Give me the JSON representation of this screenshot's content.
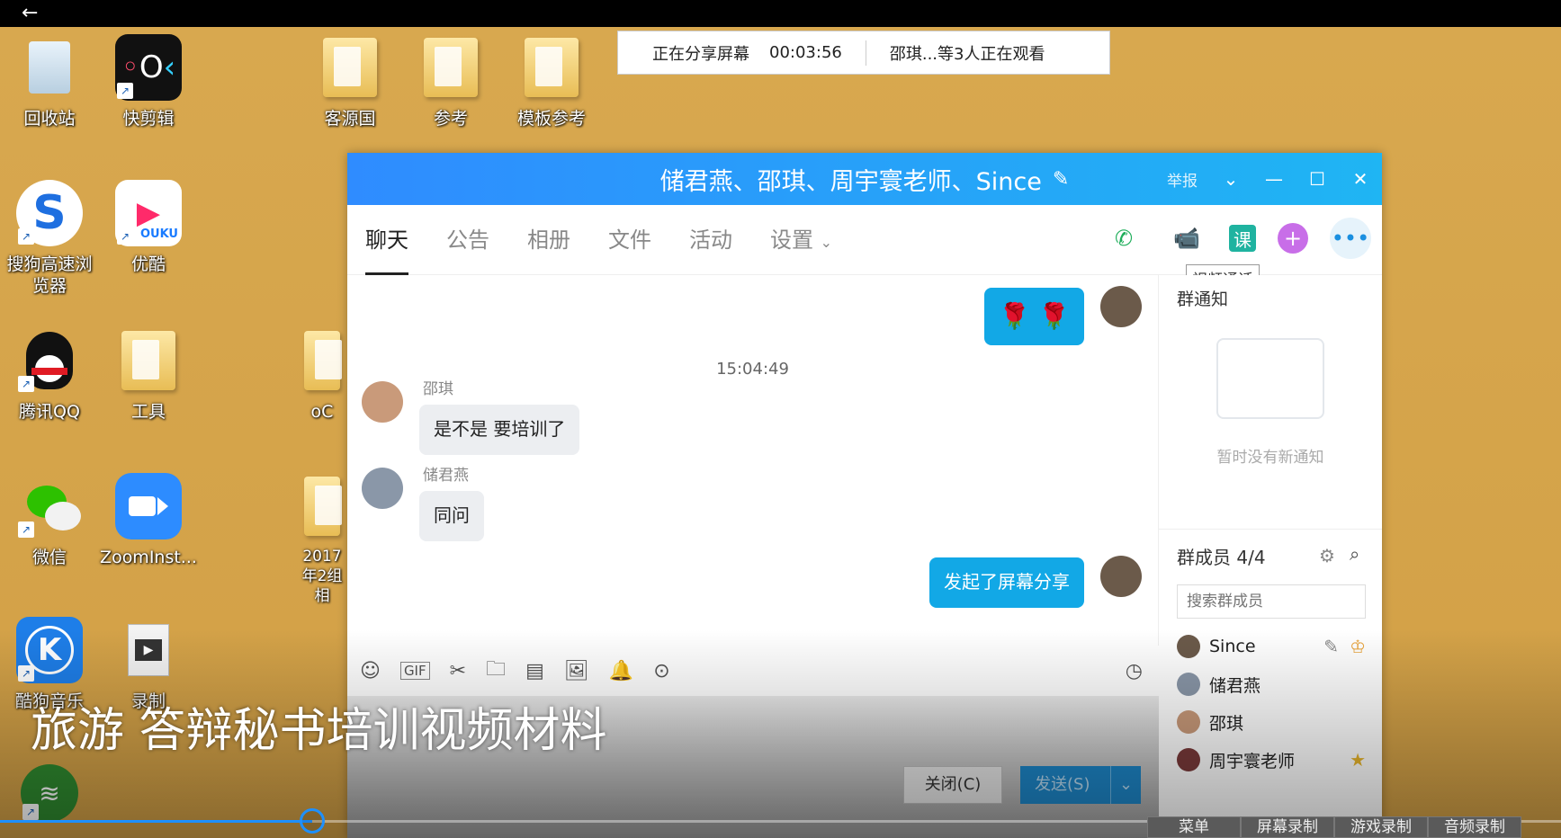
{
  "topbar": {
    "back_icon": "back-arrow-icon"
  },
  "desktop_icons": [
    {
      "label": "回收站"
    },
    {
      "label": "快剪辑"
    },
    {
      "label": "客源国"
    },
    {
      "label": "参考"
    },
    {
      "label": "模板参考"
    },
    {
      "label": "搜狗高速浏览器"
    },
    {
      "label": "优酷"
    },
    {
      "label": "腾讯QQ"
    },
    {
      "label": "工具"
    },
    {
      "label": "oC"
    },
    {
      "label": "微信"
    },
    {
      "label": "ZoomInst..."
    },
    {
      "label": "2017年2组相"
    },
    {
      "label": "酷狗音乐"
    },
    {
      "label": "录制"
    }
  ],
  "share_bar": {
    "status": "正在分享屏幕",
    "elapsed": "00:03:56",
    "viewers": "邵琪...等3人正在观看"
  },
  "qq_window": {
    "title": "储君燕、邵琪、周宇寰老师、Since",
    "report": "举报",
    "tabs": [
      "聊天",
      "公告",
      "相册",
      "文件",
      "活动",
      "设置"
    ],
    "tooltip": "视频通话",
    "tool_course": "课",
    "messages": {
      "time": "15:04:49",
      "m1_sender": "邵琪",
      "m1_text": "是不是 要培训了",
      "m2_sender": "储君燕",
      "m2_text": "同问",
      "m3_text": "发起了屏幕分享",
      "m0_emoji": "🌹 🌹"
    },
    "buttons": {
      "close": "关闭(C)",
      "send": "发送(S)"
    },
    "side": {
      "notice_title": "群通知",
      "notice_empty": "暂时没有新通知",
      "members_title": "群成员 4/4",
      "search_placeholder": "搜索群成员",
      "members": [
        "Since",
        "储君燕",
        "邵琪",
        "周宇寰老师"
      ]
    }
  },
  "caption": "旅游 答辩秘书培训视频材料",
  "video_progress": 0.2,
  "recorder_tabs": [
    "菜单",
    "屏幕录制",
    "游戏录制",
    "音频录制"
  ]
}
